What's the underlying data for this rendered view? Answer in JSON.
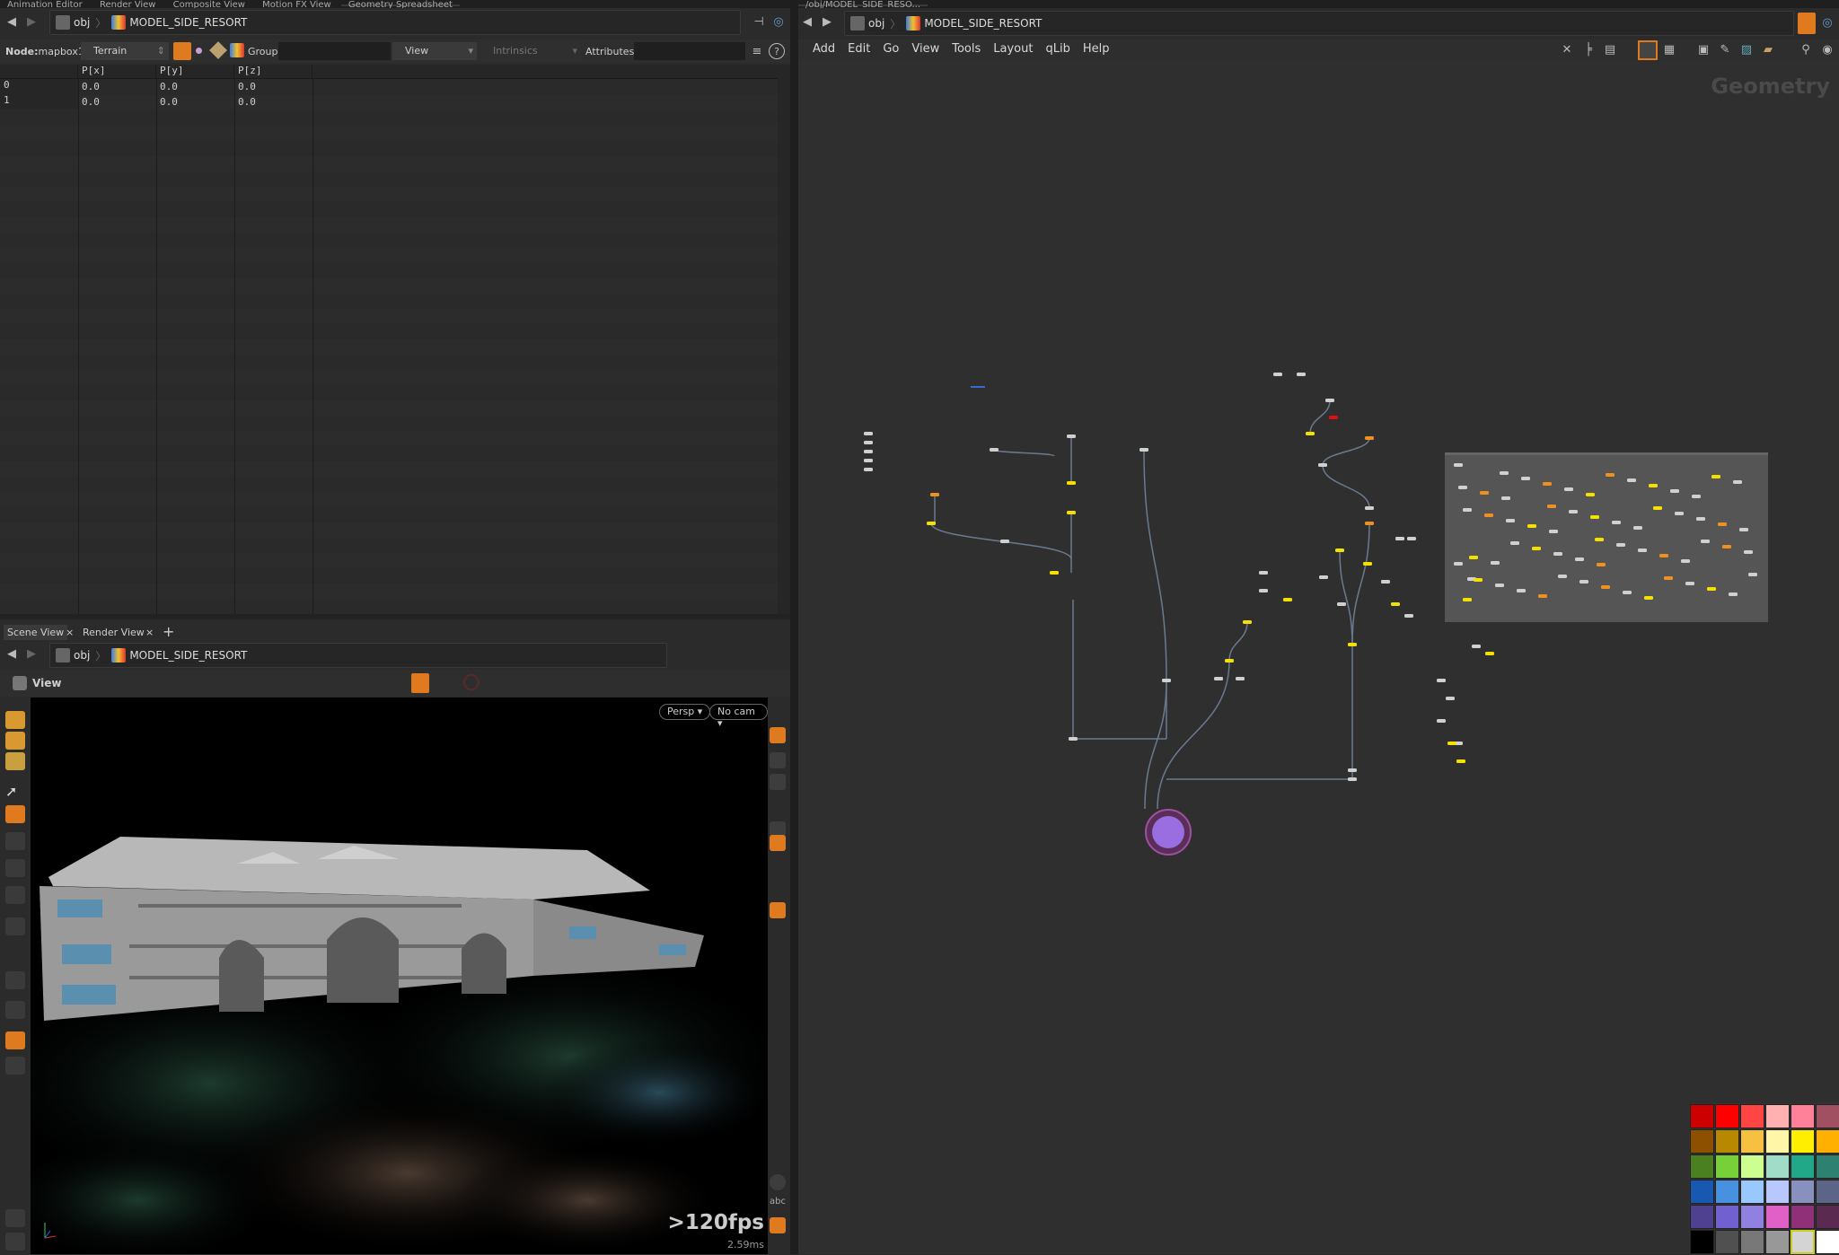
{
  "left_top_tabs": [
    "Animation Editor",
    "Render View",
    "Composite View",
    "Motion FX View",
    "Geometry Spreadsheet"
  ],
  "spreadsheet": {
    "path": {
      "root": "obj",
      "node": "MODEL_SIDE_RESORT"
    },
    "node_label": "Node:",
    "node_name": "mapbox1",
    "node_type": "Terrain",
    "group_label": "Group:",
    "group_value": "",
    "view_select": "View",
    "intrinsics_select": "Intrinsics",
    "attributes_label": "Attributes:",
    "attributes_value": "",
    "columns": [
      "",
      "P[x]",
      "P[y]",
      "P[z]"
    ],
    "rows": [
      [
        "0",
        "0.0",
        "0.0",
        "0.0"
      ],
      [
        "1",
        "0.0",
        "0.0",
        "0.0"
      ]
    ]
  },
  "scene": {
    "tabs": [
      "Scene View",
      "Render View"
    ],
    "path": {
      "root": "obj",
      "node": "MODEL_SIDE_RESORT"
    },
    "view_label": "View",
    "persp_button": "Persp",
    "cam_button": "No cam",
    "fps": ">120fps",
    "frame_time": "2.59ms",
    "abc_label": "abc",
    "active_tool": "select"
  },
  "network": {
    "tab": "/obj/MODEL_SIDE_RESO...",
    "path": {
      "root": "obj",
      "node": "MODEL_SIDE_RESORT"
    },
    "menu": [
      "Add",
      "Edit",
      "Go",
      "View",
      "Tools",
      "Layout",
      "qLib",
      "Help"
    ],
    "watermark": "Geometry",
    "output_node_color": "#9a6de0"
  },
  "palette": [
    "#cc0000",
    "#ff0000",
    "#ff4444",
    "#ffb0b0",
    "#ff8098",
    "#a05060",
    "#8c5000",
    "#b88800",
    "#f8c040",
    "#fff6a8",
    "#ffee00",
    "#ffb000",
    "#4a8020",
    "#78d038",
    "#ccff90",
    "#a0dcc8",
    "#20a888",
    "#2e8070",
    "#1858b0",
    "#4890e0",
    "#98c8ff",
    "#b8c8ff",
    "#8890c0",
    "#5c6488",
    "#504090",
    "#7060d0",
    "#9080e0",
    "#e060c8",
    "#903078",
    "#5a2a50",
    "#000000",
    "#505050",
    "#787878",
    "#989898",
    "#d4d4d4",
    "#ffffff"
  ],
  "accent": "#e07a1f"
}
